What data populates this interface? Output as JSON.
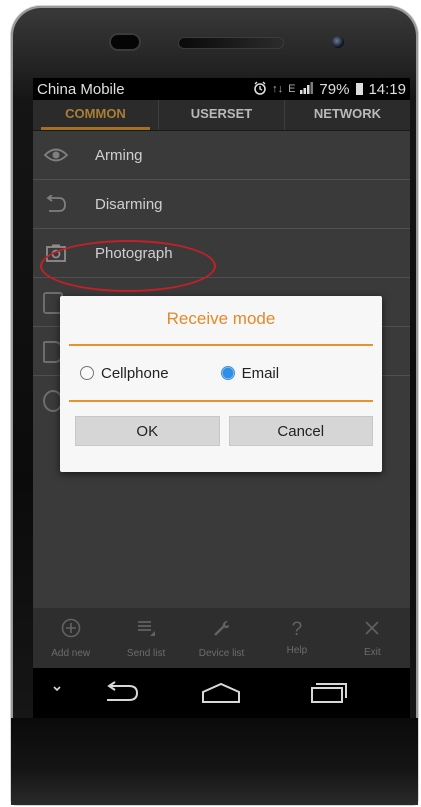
{
  "status": {
    "carrier": "China Mobile",
    "alarm_icon": "alarm-icon",
    "data_arrows": "↑↓",
    "network_marker": "E",
    "battery": "79%",
    "time": "14:19"
  },
  "tabs": [
    {
      "label": "COMMON",
      "active": true
    },
    {
      "label": "USERSET",
      "active": false
    },
    {
      "label": "NETWORK",
      "active": false
    }
  ],
  "menu": [
    {
      "label": "Arming",
      "icon": "eye-icon"
    },
    {
      "label": "Disarming",
      "icon": "undo-icon"
    },
    {
      "label": "Photograph",
      "icon": "camera-icon"
    }
  ],
  "dialog": {
    "title": "Receive mode",
    "options": [
      {
        "label": "Cellphone",
        "selected": false
      },
      {
        "label": "Email",
        "selected": true
      }
    ],
    "ok_label": "OK",
    "cancel_label": "Cancel"
  },
  "bottom_bar": [
    {
      "label": "Add new",
      "icon": "add-circle-icon"
    },
    {
      "label": "Send list",
      "icon": "list-icon"
    },
    {
      "label": "Device list",
      "icon": "wrench-icon"
    },
    {
      "label": "Help",
      "icon": "question-icon"
    },
    {
      "label": "Exit",
      "icon": "close-icon"
    }
  ],
  "colors": {
    "accent": "#e4882a",
    "highlight_ring": "#d2242b",
    "radio_selected": "#2f8ee6"
  }
}
